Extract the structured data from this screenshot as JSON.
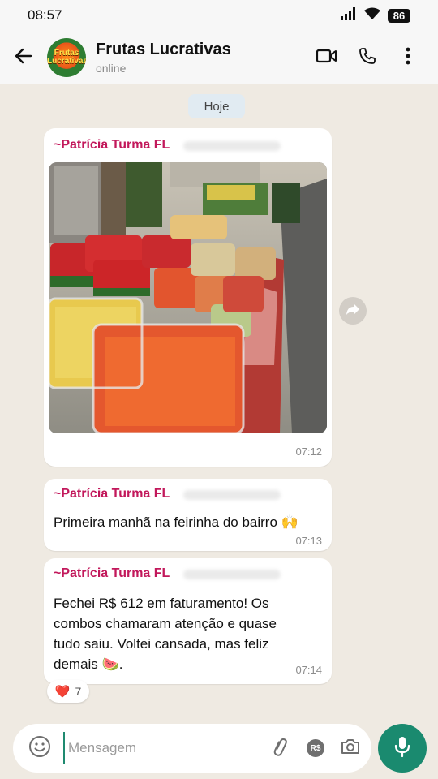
{
  "status_bar": {
    "time": "08:57",
    "battery": "86"
  },
  "header": {
    "back_icon": "arrow-left-icon",
    "avatar_label": "Frutas Lucrativas",
    "title": "Frutas Lucrativas",
    "status": "online",
    "actions": [
      "video-call-icon",
      "phone-icon",
      "more-vert-icon"
    ]
  },
  "date_chip": "Hoje",
  "messages": [
    {
      "sender": "~Patrícia Turma FL",
      "type": "image",
      "time": "07:12"
    },
    {
      "sender": "~Patrícia Turma FL",
      "text": "Primeira manhã na feirinha do bairro 🙌",
      "time": "07:13"
    },
    {
      "sender": "~Patrícia Turma FL",
      "text": "Fechei R$ 612 em faturamento! Os combos chamaram atenção e quase tudo saiu. Voltei cansada, mas feliz demais 🍉.",
      "time": "07:14"
    }
  ],
  "reaction": {
    "emoji": "❤️",
    "count": "7"
  },
  "composer": {
    "placeholder": "Mensagem",
    "icons": [
      "emoji-icon",
      "attach-icon",
      "payment-icon",
      "camera-icon"
    ],
    "payment_label": "R$"
  },
  "colors": {
    "accent": "#1a8a6f",
    "sender": "#c2185b",
    "background": "#efeae2"
  }
}
